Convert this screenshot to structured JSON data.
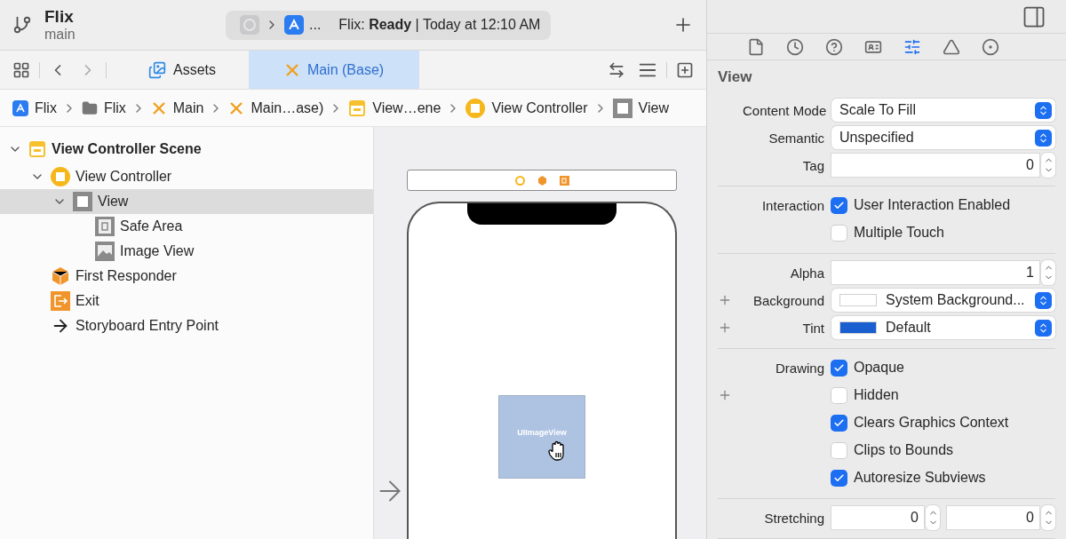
{
  "toolbar": {
    "project": "Flix",
    "branch": "main",
    "status": {
      "ellipsis": "...",
      "text": "Flix: **Ready** | Today at 12:10 AM"
    }
  },
  "editor_tabs": [
    {
      "label": "Assets",
      "kind": "assets",
      "selected": false
    },
    {
      "label": "Main (Base)",
      "kind": "storyboard",
      "selected": true
    }
  ],
  "breadcrumbs": [
    {
      "label": "Flix",
      "kind": "app"
    },
    {
      "label": "Flix",
      "kind": "folder"
    },
    {
      "label": "Main",
      "kind": "storyboard"
    },
    {
      "label": "Main…ase)",
      "kind": "storyboard"
    },
    {
      "label": "View…ene",
      "kind": "scene"
    },
    {
      "label": "View Controller",
      "kind": "controller"
    },
    {
      "label": "View",
      "kind": "view"
    }
  ],
  "outline": [
    {
      "label": "View Controller Scene",
      "kind": "scene",
      "expanded": true,
      "selected": false,
      "children": [
        {
          "label": "View Controller",
          "kind": "controller",
          "expanded": true,
          "selected": false,
          "children": [
            {
              "label": "View",
              "kind": "view",
              "expanded": true,
              "selected": true,
              "children": [
                {
                  "label": "Safe Area",
                  "kind": "safe-area",
                  "selected": false
                },
                {
                  "label": "Image View",
                  "kind": "image",
                  "selected": false
                }
              ]
            }
          ]
        },
        {
          "label": "First Responder",
          "kind": "responder",
          "selected": false
        },
        {
          "label": "Exit",
          "kind": "exit",
          "selected": false
        },
        {
          "label": "Storyboard Entry Point",
          "kind": "entry",
          "selected": false
        }
      ]
    }
  ],
  "canvas": {
    "image_view_label": "UIImageView"
  },
  "inspector": {
    "tabs": [
      {
        "kind": "file",
        "selected": false
      },
      {
        "kind": "history",
        "selected": false
      },
      {
        "kind": "help",
        "selected": false
      },
      {
        "kind": "identity",
        "selected": false
      },
      {
        "kind": "attributes",
        "selected": true
      },
      {
        "kind": "size",
        "selected": false
      },
      {
        "kind": "connections",
        "selected": false
      }
    ],
    "section": "View",
    "groups": [
      {
        "rows": [
          {
            "kind": "select",
            "label": "Content Mode",
            "value": "Scale To Fill"
          },
          {
            "kind": "select",
            "label": "Semantic",
            "value": "Unspecified"
          },
          {
            "kind": "stepper",
            "label": "Tag",
            "value": "0"
          }
        ]
      },
      {
        "rows": [
          {
            "kind": "checkbox",
            "label": "Interaction",
            "text": "User Interaction Enabled",
            "checked": true
          },
          {
            "kind": "checkbox",
            "text": "Multiple Touch",
            "checked": false
          }
        ]
      },
      {
        "rows": [
          {
            "kind": "stepper",
            "label": "Alpha",
            "value": "1"
          },
          {
            "kind": "color",
            "label": "Background",
            "add_button": true,
            "color": "#ffffff",
            "value": "System Background..."
          },
          {
            "kind": "color",
            "label": "Tint",
            "add_button": true,
            "color": "#1a5fd0",
            "value": "Default"
          }
        ]
      },
      {
        "rows": [
          {
            "kind": "checkbox",
            "label": "Drawing",
            "text": "Opaque",
            "checked": true
          },
          {
            "kind": "checkbox",
            "text": "Hidden",
            "checked": false,
            "add_button": true
          },
          {
            "kind": "checkbox",
            "text": "Clears Graphics Context",
            "checked": true
          },
          {
            "kind": "checkbox",
            "text": "Clips to Bounds",
            "checked": false
          },
          {
            "kind": "checkbox",
            "text": "Autoresize Subviews",
            "checked": true
          }
        ]
      },
      {
        "rows": [
          {
            "kind": "stepper2",
            "label": "Stretching",
            "values": [
              "0",
              "0"
            ]
          }
        ]
      }
    ]
  }
}
